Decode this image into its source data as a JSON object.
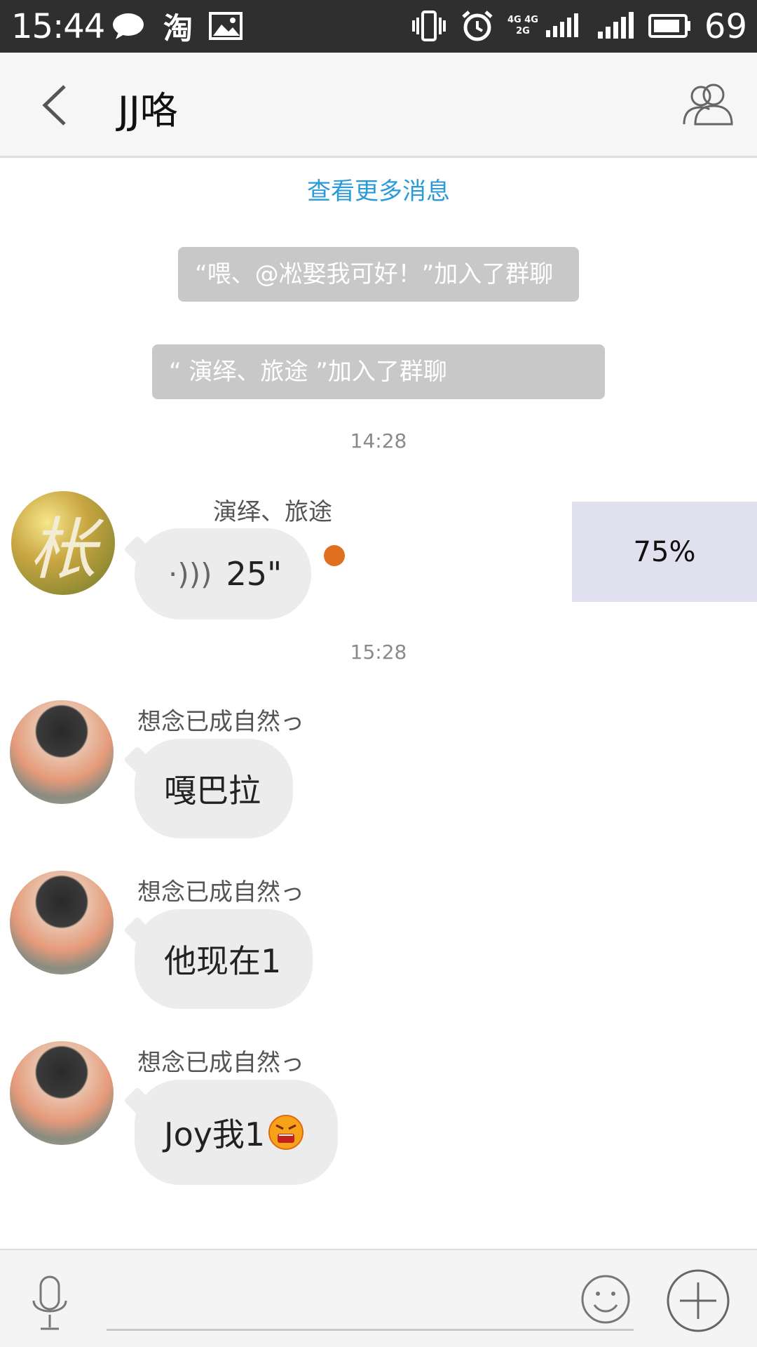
{
  "status_bar": {
    "time": "15:44",
    "battery": "69",
    "icons": [
      "chat-bubble-icon",
      "taobao-icon",
      "gallery-icon",
      "vibrate-icon",
      "alarm-icon",
      "network-4g-icon",
      "signal-icon",
      "battery-icon"
    ],
    "taobao_char": "淘",
    "net_label_top": "4G 4G",
    "net_label_bottom": "2G"
  },
  "header": {
    "title": "JJ咯"
  },
  "chat": {
    "load_more": "查看更多消息",
    "system_messages": [
      "“喂、@凇娶我可好！”加入了群聊",
      "“           演绎、旅途           ”加入了群聊"
    ],
    "timestamps": [
      "14:28",
      "15:28"
    ],
    "messages": [
      {
        "sender": "演绎、旅途",
        "avatar_char": "枨",
        "type": "voice",
        "voice_symbol": "·)))",
        "duration": "25\"",
        "unread": true
      },
      {
        "sender": "想念已成自然っ",
        "type": "text",
        "text": "嘎巴拉"
      },
      {
        "sender": "想念已成自然っ",
        "type": "text",
        "text": "他现在1"
      },
      {
        "sender": "想念已成自然っ",
        "type": "text",
        "text": "Joy我1",
        "emoji": "angry-face-icon"
      }
    ],
    "overlay_progress": "75%"
  },
  "input_bar": {
    "placeholder": "",
    "buttons": [
      "mic-icon",
      "emoji-icon",
      "plus-icon"
    ]
  },
  "colors": {
    "link": "#2a9ad9",
    "status_bar_bg": "#2f2f2f",
    "bubble_bg": "#ececec",
    "system_bg": "#c8c8c8",
    "unread_dot": "#e07020"
  }
}
